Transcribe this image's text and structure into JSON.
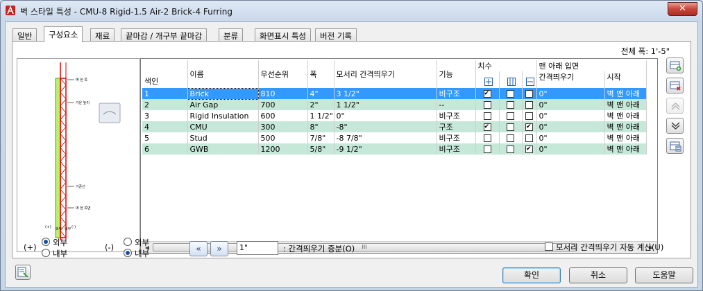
{
  "window": {
    "title": "벽 스타일 특성 - CMU-8 Rigid-1.5 Air-2 Brick-4 Furring",
    "close_label": "✕"
  },
  "tabs": [
    {
      "label": "일반"
    },
    {
      "label": "구성요소"
    },
    {
      "label": "재료"
    },
    {
      "label": "끝마감 / 개구부 끝마감"
    },
    {
      "label": "분류"
    },
    {
      "label": "화면표시 특성"
    },
    {
      "label": "버전 기록"
    }
  ],
  "active_tab": "구성요소",
  "total_width": "전체 폭: 1'-5\"",
  "preview": {
    "labels": [
      "벽 한 쪽",
      "가운 높이",
      "기준선",
      "벽 한 쪽면",
      "(+)",
      "외부",
      "내부",
      "(-)"
    ]
  },
  "grid": {
    "headers": {
      "index": "색인",
      "name": "이름",
      "priority": "우선순위",
      "width": "폭",
      "edge_offset": "모서리 간격띄우기",
      "function": "기능",
      "dimension": "치수",
      "bottom_elevation": "맨 아래 입면",
      "offset": "간격띄우기",
      "start": "시작"
    },
    "rows": [
      {
        "index": "1",
        "name": "Brick",
        "priority": "810",
        "width": "4\"",
        "edge_offset": "3 1/2\"",
        "function": "비구조",
        "c1": true,
        "c2": false,
        "c3": false,
        "offset": "0\"",
        "start": "벽 맨 아래"
      },
      {
        "index": "2",
        "name": "Air Gap",
        "priority": "700",
        "width": "2\"",
        "edge_offset": "1 1/2\"",
        "function": "--",
        "c1": false,
        "c2": false,
        "c3": false,
        "offset": "0\"",
        "start": "벽 맨 아래"
      },
      {
        "index": "3",
        "name": "Rigid Insulation",
        "priority": "600",
        "width": "1 1/2\"",
        "edge_offset": "0\"",
        "function": "비구조",
        "c1": false,
        "c2": false,
        "c3": false,
        "offset": "0\"",
        "start": "벽 맨 아래"
      },
      {
        "index": "4",
        "name": "CMU",
        "priority": "300",
        "width": "8\"",
        "edge_offset": "-8\"",
        "function": "구조",
        "c1": true,
        "c2": false,
        "c3": true,
        "offset": "0\"",
        "start": "벽 맨 아래"
      },
      {
        "index": "5",
        "name": "Stud",
        "priority": "500",
        "width": "7/8\"",
        "edge_offset": "-8 7/8\"",
        "function": "비구조",
        "c1": false,
        "c2": false,
        "c3": false,
        "offset": "0\"",
        "start": "벽 맨 아래"
      },
      {
        "index": "6",
        "name": "GWB",
        "priority": "1200",
        "width": "5/8\"",
        "edge_offset": "-9 1/2\"",
        "function": "비구조",
        "c1": false,
        "c2": false,
        "c3": true,
        "offset": "0\"",
        "start": "벽 맨 아래"
      }
    ],
    "scroll_thumb_label": "III"
  },
  "bottom": {
    "plus_label": "(+)",
    "minus_label": "(-)",
    "plus_options": [
      "외부",
      "내부"
    ],
    "minus_options": [
      "외부",
      "내부"
    ],
    "plus_selected": "외부",
    "minus_selected": "내부",
    "prev_label": "«",
    "next_label": "»",
    "increment_value": "1\"",
    "increment_label": ": 간격띄우기 증분(O)",
    "auto_calc_label": "모서리 간격띄우기 자동 계산(U)",
    "auto_calc_checked": false
  },
  "buttons": {
    "ok": "확인",
    "cancel": "취소",
    "help": "도움말"
  }
}
